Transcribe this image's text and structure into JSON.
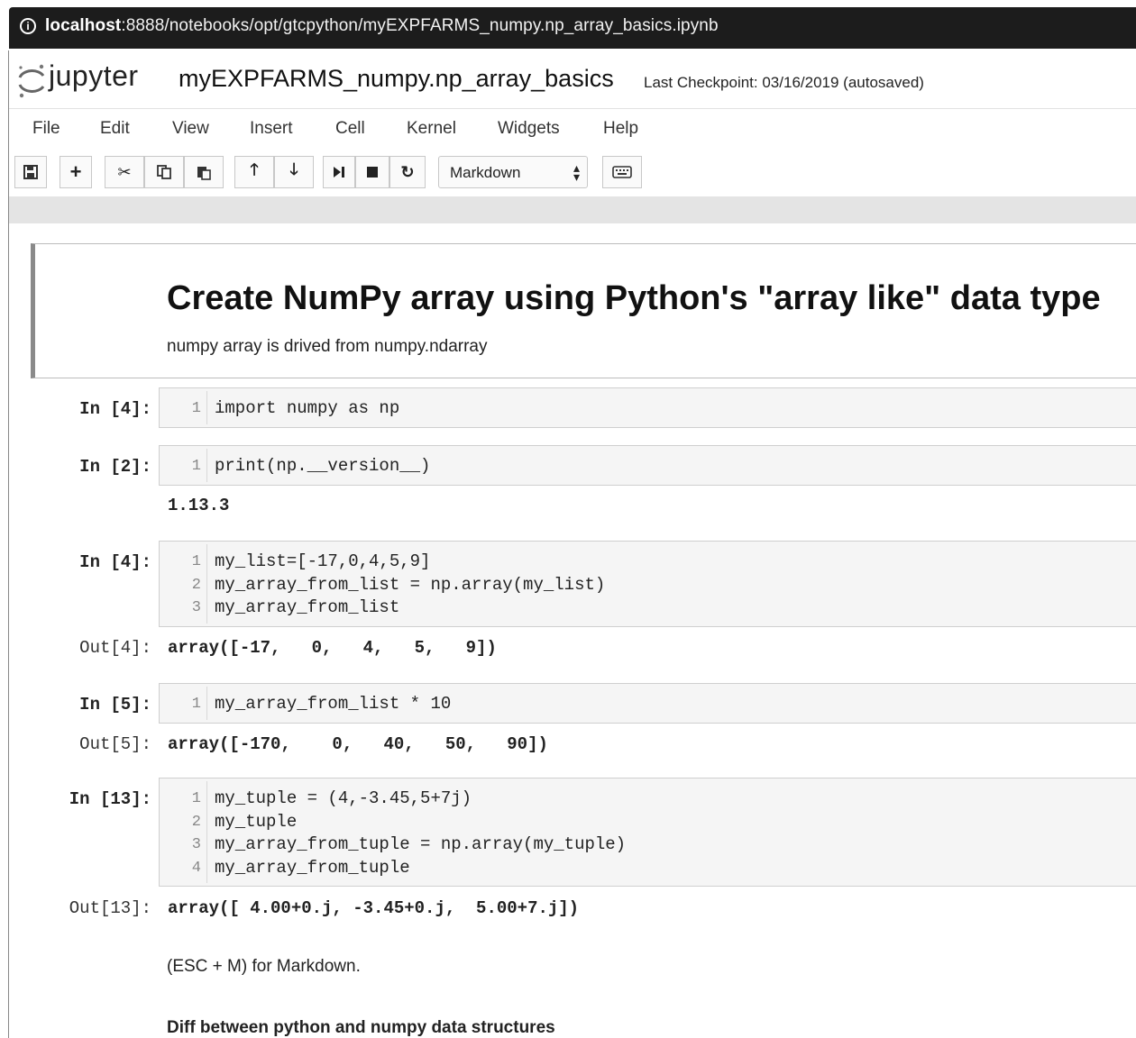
{
  "url_bar": {
    "host": "localhost",
    "path": ":8888/notebooks/opt/gtcpython/myEXPFARMS_numpy.np_array_basics.ipynb"
  },
  "header": {
    "brand": "jupyter",
    "notebook_title": "myEXPFARMS_numpy.np_array_basics",
    "checkpoint": "Last Checkpoint: 03/16/2019 (autosaved)"
  },
  "menu": [
    "File",
    "Edit",
    "View",
    "Insert",
    "Cell",
    "Kernel",
    "Widgets",
    "Help"
  ],
  "toolbar": {
    "cell_type": "Markdown"
  },
  "markdown_top": {
    "heading": "Create NumPy array using Python's \"array like\" data type",
    "paragraph": "numpy array is drived from numpy.ndarray"
  },
  "cells": [
    {
      "prompt": "In [4]:",
      "lines": [
        {
          "n": "1",
          "code": "import numpy as np"
        }
      ]
    },
    {
      "prompt": "In [2]:",
      "lines": [
        {
          "n": "1",
          "code": "print(np.__version__)"
        }
      ],
      "output": "1.13.3"
    },
    {
      "prompt": "In [4]:",
      "lines": [
        {
          "n": "1",
          "code": "my_list=[-17,0,4,5,9]"
        },
        {
          "n": "2",
          "code": "my_array_from_list = np.array(my_list)"
        },
        {
          "n": "3",
          "code": "my_array_from_list"
        }
      ],
      "out_prompt": "Out[4]:",
      "output": "array([-17,   0,   4,   5,   9])"
    },
    {
      "prompt": "In [5]:",
      "lines": [
        {
          "n": "1",
          "code": "my_array_from_list * 10"
        }
      ],
      "out_prompt": "Out[5]:",
      "output": "array([-170,    0,   40,   50,   90])"
    },
    {
      "prompt": "In [13]:",
      "lines": [
        {
          "n": "1",
          "code": "my_tuple = (4,-3.45,5+7j)"
        },
        {
          "n": "2",
          "code": "my_tuple"
        },
        {
          "n": "3",
          "code": "my_array_from_tuple = np.array(my_tuple)"
        },
        {
          "n": "4",
          "code": "my_array_from_tuple"
        }
      ],
      "out_prompt": "Out[13]:",
      "output": "array([ 4.00+0.j, -3.45+0.j,  5.00+7.j])"
    }
  ],
  "markdown_bottom": {
    "note": "(ESC + M) for Markdown.",
    "subheading": "Diff between python and numpy data structures"
  }
}
